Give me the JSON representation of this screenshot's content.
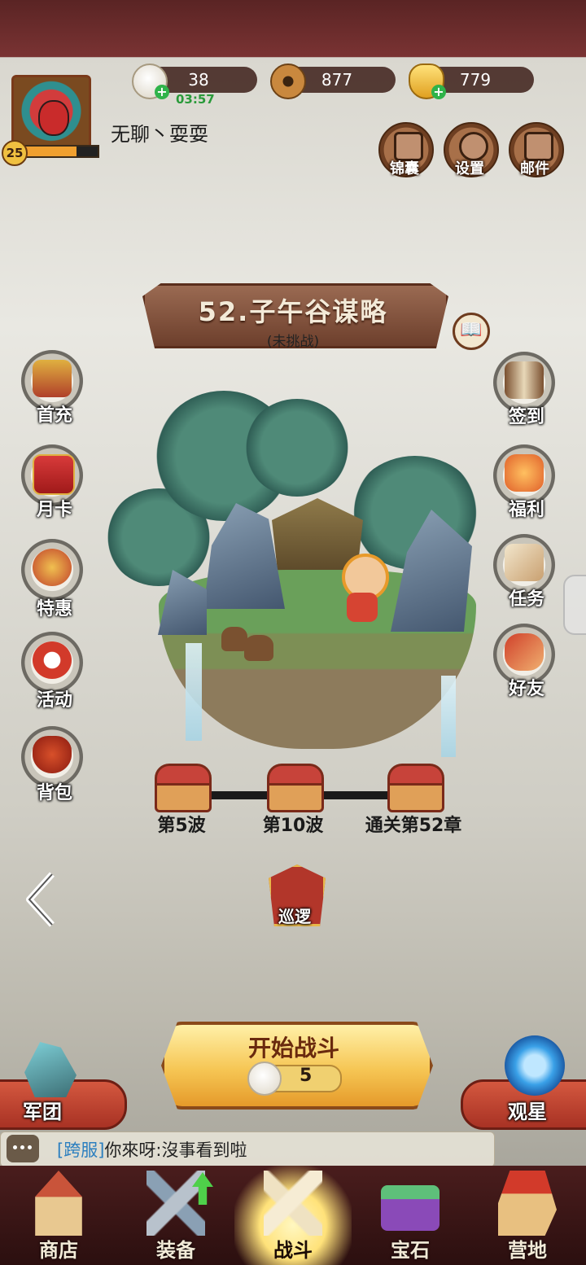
{
  "player": {
    "name": "无聊丶耍耍",
    "level": "25",
    "xp_fraction": 0.72
  },
  "resources": [
    {
      "icon": "steamed-bun-icon",
      "value": "38",
      "timer": "03:57"
    },
    {
      "icon": "copper-coin-icon",
      "value": "877"
    },
    {
      "icon": "gold-ingot-icon",
      "value": "779"
    }
  ],
  "top_buttons": [
    {
      "icon": "scroll-bag-icon",
      "label": "锦囊"
    },
    {
      "icon": "gear-icon",
      "label": "设置"
    },
    {
      "icon": "mail-icon",
      "label": "邮件"
    }
  ],
  "stage": {
    "title": "52.子午谷谋略",
    "status": "(未挑战)"
  },
  "left_menu": [
    {
      "icon": "treasure-chest-icon",
      "label": "首充"
    },
    {
      "icon": "red-envelope-icon",
      "label": "月卡"
    },
    {
      "icon": "coin-bag-icon",
      "label": "特惠"
    },
    {
      "icon": "lantern-drum-icon",
      "label": "活动"
    },
    {
      "icon": "bag-icon",
      "label": "背包"
    }
  ],
  "right_menu": [
    {
      "icon": "scroll-icon",
      "label": "签到"
    },
    {
      "icon": "lantern-icon",
      "label": "福利"
    },
    {
      "icon": "quill-paper-icon",
      "label": "任务"
    },
    {
      "icon": "handshake-icon",
      "label": "好友"
    }
  ],
  "progress": [
    {
      "label": "第5波"
    },
    {
      "label": "第10波"
    },
    {
      "label": "通关第52章"
    }
  ],
  "patrol": {
    "label": "巡逻"
  },
  "start": {
    "label": "开始战斗",
    "cost": "5"
  },
  "legion": {
    "label": "军团"
  },
  "stargazing": {
    "label": "观星"
  },
  "chat": {
    "channel": "[跨服]",
    "message": "你來呀:沒事看到啦"
  },
  "nav": [
    {
      "icon": "shop-icon",
      "label": "商店"
    },
    {
      "icon": "equipment-icon",
      "label": "装备"
    },
    {
      "icon": "crossed-sabers-icon",
      "label": "战斗"
    },
    {
      "icon": "gem-chest-icon",
      "label": "宝石"
    },
    {
      "icon": "camp-flag-icon",
      "label": "营地"
    }
  ],
  "colors": {
    "accent_gold": "#f6c654",
    "nav_bg": "#3a1515",
    "chat_channel": "#2c7fbf"
  }
}
